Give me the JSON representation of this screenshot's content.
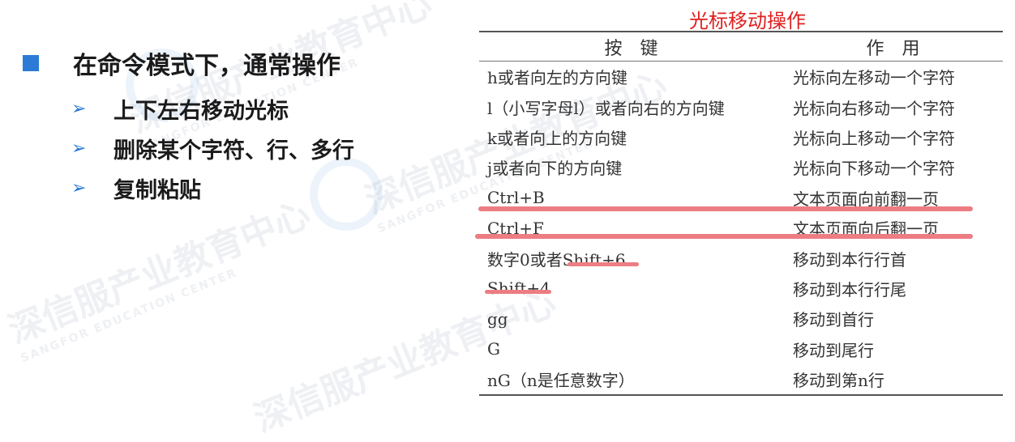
{
  "watermark": {
    "text": "深信服产业教育中心",
    "subtext": "SANGFOR EDUCATION CENTER"
  },
  "main_point": "在命令模式下，通常操作",
  "sub_points": [
    "上下左右移动光标",
    "删除某个字符、行、多行",
    "复制粘贴"
  ],
  "table": {
    "title": "光标移动操作",
    "headers": [
      "按　键",
      "作　用"
    ],
    "rows": [
      [
        "h或者向左的方向键",
        "光标向左移动一个字符"
      ],
      [
        "l（小写字母l）或者向右的方向键",
        "光标向右移动一个字符"
      ],
      [
        "k或者向上的方向键",
        "光标向上移动一个字符"
      ],
      [
        "j或者向下的方向键",
        "光标向下移动一个字符"
      ],
      [
        "Ctrl+B",
        "文本页面向前翻一页"
      ],
      [
        "Ctrl+F",
        "文本页面向后翻一页"
      ],
      [
        "数字0或者Shift+6",
        "移动到本行行首"
      ],
      [
        "Shift+4",
        "移动到本行行尾"
      ],
      [
        "gg",
        "移动到首行"
      ],
      [
        "G",
        "移动到尾行"
      ],
      [
        "nG（n是任意数字）",
        "移动到第n行"
      ]
    ]
  },
  "colors": {
    "accent": "#2b7bd6",
    "title_red": "#e02020",
    "marker": "#ec7d82"
  }
}
